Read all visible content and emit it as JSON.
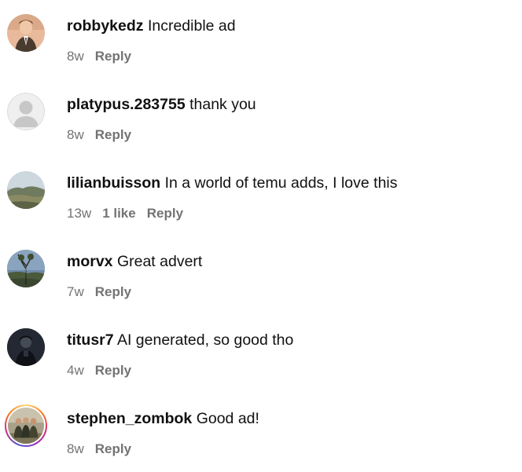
{
  "comments": [
    {
      "username": "robbykedz",
      "text": "Incredible ad",
      "time": "8w",
      "likes": "",
      "reply": "Reply",
      "avatar": "person-photo-avatar"
    },
    {
      "username": "platypus.283755",
      "text": "thank you",
      "time": "8w",
      "likes": "",
      "reply": "Reply",
      "avatar": "default-user-avatar"
    },
    {
      "username": "lilianbuisson",
      "text": "In a world of temu adds, I love this",
      "time": "13w",
      "likes": "1 like",
      "reply": "Reply",
      "avatar": "landscape-photo-avatar"
    },
    {
      "username": "morvx",
      "text": "Great advert",
      "time": "7w",
      "likes": "",
      "reply": "Reply",
      "avatar": "tree-photo-avatar"
    },
    {
      "username": "titusr7",
      "text": "AI generated, so good tho",
      "time": "4w",
      "likes": "",
      "reply": "Reply",
      "avatar": "dark-figure-avatar"
    },
    {
      "username": "stephen_zombok",
      "text": "Good ad!",
      "time": "8w",
      "likes": "",
      "reply": "Reply",
      "avatar": "group-photo-story-avatar"
    }
  ],
  "colors": {
    "meta_text": "#737373",
    "username": "#111111",
    "story_ring": [
      "#feda75",
      "#fa7e1e",
      "#d62976",
      "#962fbf",
      "#4f5bd5"
    ]
  }
}
